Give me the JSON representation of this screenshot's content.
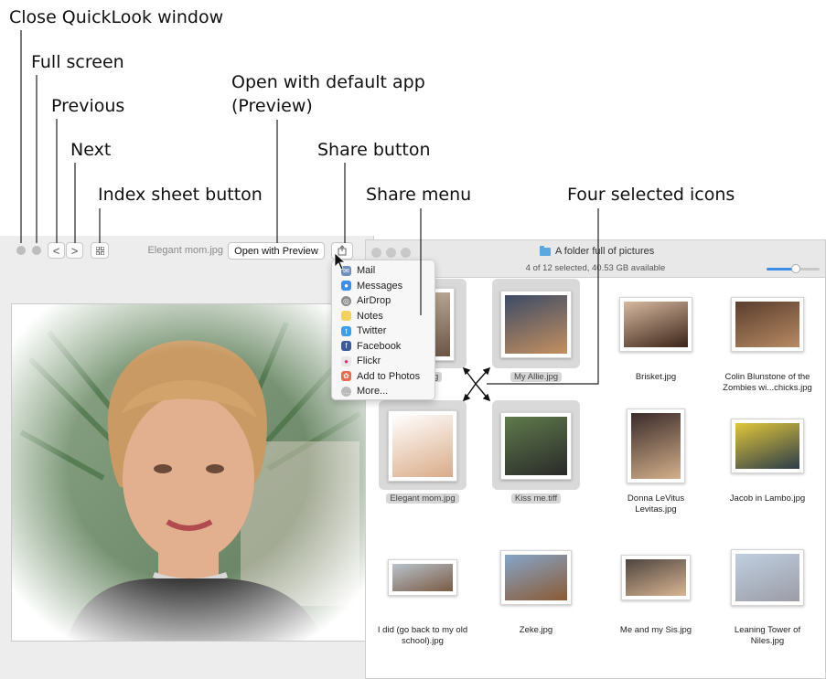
{
  "callouts": {
    "close": "Close QuickLook window",
    "full_screen": "Full screen",
    "previous": "Previous",
    "next": "Next",
    "index_sheet": "Index sheet button",
    "open_with_line1": "Open with default app",
    "open_with_line2": "(Preview)",
    "share_button": "Share button",
    "share_menu": "Share menu",
    "four_selected": "Four selected icons"
  },
  "quicklook": {
    "file_title": "Elegant mom.jpg",
    "open_button_label": "Open with Preview",
    "prev_glyph": "<",
    "next_glyph": ">"
  },
  "share_menu": {
    "items": [
      {
        "label": "Mail",
        "icon": "mail-icon",
        "color": "#6d8fbf"
      },
      {
        "label": "Messages",
        "icon": "messages-icon",
        "color": "#3b8fe8"
      },
      {
        "label": "AirDrop",
        "icon": "airdrop-icon",
        "color": "#8a8a8a"
      },
      {
        "label": "Notes",
        "icon": "notes-icon",
        "color": "#f2d45c"
      },
      {
        "label": "Twitter",
        "icon": "twitter-icon",
        "color": "#3aa0ee"
      },
      {
        "label": "Facebook",
        "icon": "facebook-icon",
        "color": "#3b5b99"
      },
      {
        "label": "Flickr",
        "icon": "flickr-icon",
        "color": "#e8e8e8"
      },
      {
        "label": "Add to Photos",
        "icon": "photos-icon",
        "color": "#e86b4b"
      },
      {
        "label": "More...",
        "icon": "more-icon",
        "color": "#bbbbbb"
      }
    ]
  },
  "finder": {
    "title": "A folder full of pictures",
    "status": "4 of 12 selected, 40.53 GB available",
    "zoom_level": 0.55,
    "files": [
      {
        "name": "...y's.jpg",
        "name2": "",
        "selected": true
      },
      {
        "name": "My Allie.jpg",
        "name2": "",
        "selected": true
      },
      {
        "name": "Brisket.jpg",
        "name2": "",
        "selected": false
      },
      {
        "name": "Colin Blunstone of the",
        "name2": "Zombies wi...chicks.jpg",
        "selected": false
      },
      {
        "name": "Elegant mom.jpg",
        "name2": "",
        "selected": true
      },
      {
        "name": "Kiss me.tiff",
        "name2": "",
        "selected": true
      },
      {
        "name": "Donna LeVitus",
        "name2": "Levitas.jpg",
        "selected": false
      },
      {
        "name": "Jacob in Lambo.jpg",
        "name2": "",
        "selected": false
      },
      {
        "name": "I did (go back to my old",
        "name2": "school).jpg",
        "selected": false
      },
      {
        "name": "Zeke.jpg",
        "name2": "",
        "selected": false
      },
      {
        "name": "Me and my Sis.jpg",
        "name2": "",
        "selected": false
      },
      {
        "name": "Leaning Tower of",
        "name2": "Niles.jpg",
        "selected": false
      }
    ]
  }
}
